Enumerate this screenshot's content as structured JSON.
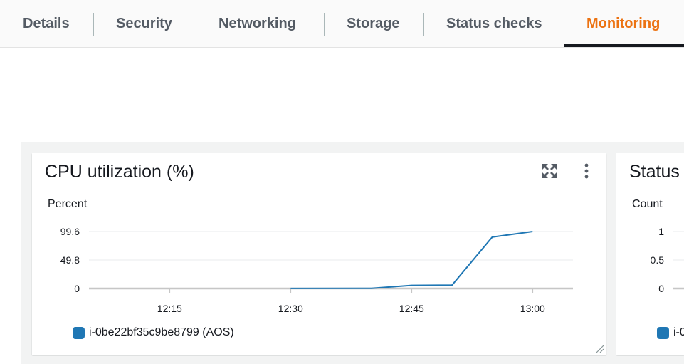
{
  "tabs": [
    {
      "label": "Details",
      "active": false
    },
    {
      "label": "Security",
      "active": false
    },
    {
      "label": "Networking",
      "active": false
    },
    {
      "label": "Storage",
      "active": false
    },
    {
      "label": "Status checks",
      "active": false
    },
    {
      "label": "Monitoring",
      "active": true
    }
  ],
  "colors": {
    "active_tab": "#ec7211",
    "series_line": "#1f77b4",
    "series_swatch": "#1f77b4"
  },
  "cpu_panel": {
    "title": "CPU utilization (%)",
    "unit": "Percent",
    "expand_icon": "expand-arrows-icon",
    "menu_icon": "vertical-ellipsis-icon",
    "legend_label": "i-0be22bf35c9be8799 (AOS)"
  },
  "status_panel": {
    "title": "Status",
    "unit": "Count",
    "legend_label": "i-0"
  },
  "chart_data": [
    {
      "type": "line",
      "title": "CPU utilization (%)",
      "ylabel": "Percent",
      "xlabel": "",
      "ylim": [
        0,
        99.6
      ],
      "yticks": [
        "0",
        "49.8",
        "99.6"
      ],
      "ytick_values": [
        0,
        49.8,
        99.6
      ],
      "xticks": [
        "12:15",
        "12:30",
        "12:45",
        "13:00"
      ],
      "xtick_minutes": [
        15,
        30,
        45,
        60
      ],
      "xlim_minutes": [
        5,
        65
      ],
      "grid": true,
      "legend_position": "bottom-left",
      "series": [
        {
          "name": "i-0be22bf35c9be8799 (AOS)",
          "x_minutes": [
            30,
            40,
            45,
            50,
            55,
            60
          ],
          "y": [
            0.1,
            0.2,
            5.5,
            5.8,
            90,
            99.6
          ]
        }
      ]
    },
    {
      "type": "line",
      "title": "Status",
      "ylabel": "Count",
      "ylim": [
        0,
        1
      ],
      "yticks": [
        "0",
        "0.5",
        "1"
      ],
      "ytick_values": [
        0,
        0.5,
        1
      ],
      "grid": true,
      "legend_position": "bottom-left",
      "series": [
        {
          "name": "i-0",
          "x_minutes": [],
          "y": []
        }
      ]
    }
  ]
}
